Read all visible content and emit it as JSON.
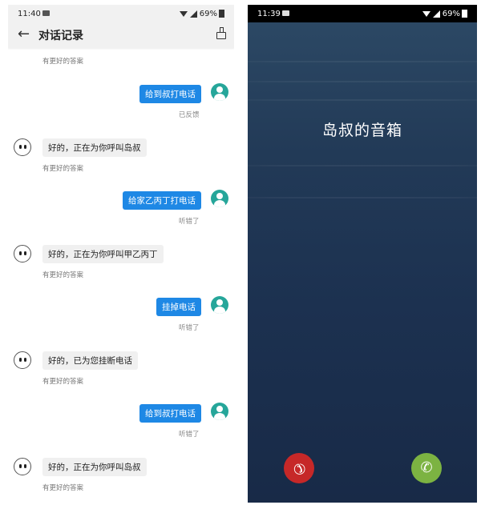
{
  "left": {
    "status": {
      "time": "11:40",
      "battery": "69%"
    },
    "title": "对话记录",
    "top_meta": "有更好的答案",
    "messages": [
      {
        "user": "给到叔打电话",
        "user_meta": "已反馈",
        "bot": "好的，正在为你呼叫岛叔",
        "bot_meta": "有更好的答案"
      },
      {
        "user": "给家乙丙丁打电话",
        "user_meta": "听错了",
        "bot": "好的，正在为你呼叫甲乙丙丁",
        "bot_meta": "有更好的答案"
      },
      {
        "user": "挂掉电话",
        "user_meta": "听错了",
        "bot": "好的，已为您挂断电话",
        "bot_meta": "有更好的答案"
      },
      {
        "user": "给到叔打电话",
        "user_meta": "听错了",
        "bot": "好的，正在为你呼叫岛叔",
        "bot_meta": "有更好的答案"
      }
    ]
  },
  "right": {
    "status": {
      "time": "11:39",
      "battery": "69%"
    },
    "caller": "岛叔的音箱",
    "decline_icon": "phone-hangup-icon",
    "accept_icon": "phone-answer-icon"
  },
  "colors": {
    "user_bubble": "#1e88e5",
    "decline": "#c62828",
    "accept": "#7cb342",
    "avatar": "#26a69a"
  }
}
